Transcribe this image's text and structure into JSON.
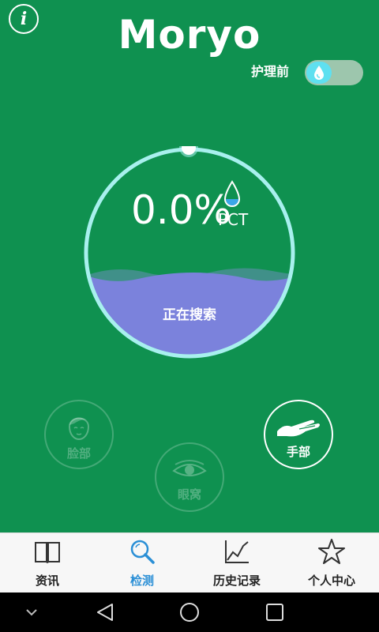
{
  "header": {
    "info_label": "i",
    "logo": "Moryo",
    "mode_label": "护理前",
    "mode_toggle_on": true
  },
  "gauge": {
    "value": "0.0%",
    "unit": "PCT",
    "level_fraction": 0.0,
    "status": "正在搜索"
  },
  "body_parts": [
    {
      "label": "脸部",
      "icon": "face-icon",
      "active": false
    },
    {
      "label": "眼窝",
      "icon": "eye-icon",
      "active": false
    },
    {
      "label": "手部",
      "icon": "hand-icon",
      "active": true
    }
  ],
  "bottom_nav": [
    {
      "label": "资讯",
      "icon": "book-icon",
      "active": false
    },
    {
      "label": "检测",
      "icon": "search-icon",
      "active": true
    },
    {
      "label": "历史记录",
      "icon": "chart-icon",
      "active": false
    },
    {
      "label": "个人中心",
      "icon": "star-icon",
      "active": false
    }
  ],
  "colors": {
    "background": "#0f9150",
    "ring": "#a8f0ee",
    "wave": "#7b82dc",
    "nav_active": "#2a8fd6",
    "nav_inactive": "#222222"
  }
}
